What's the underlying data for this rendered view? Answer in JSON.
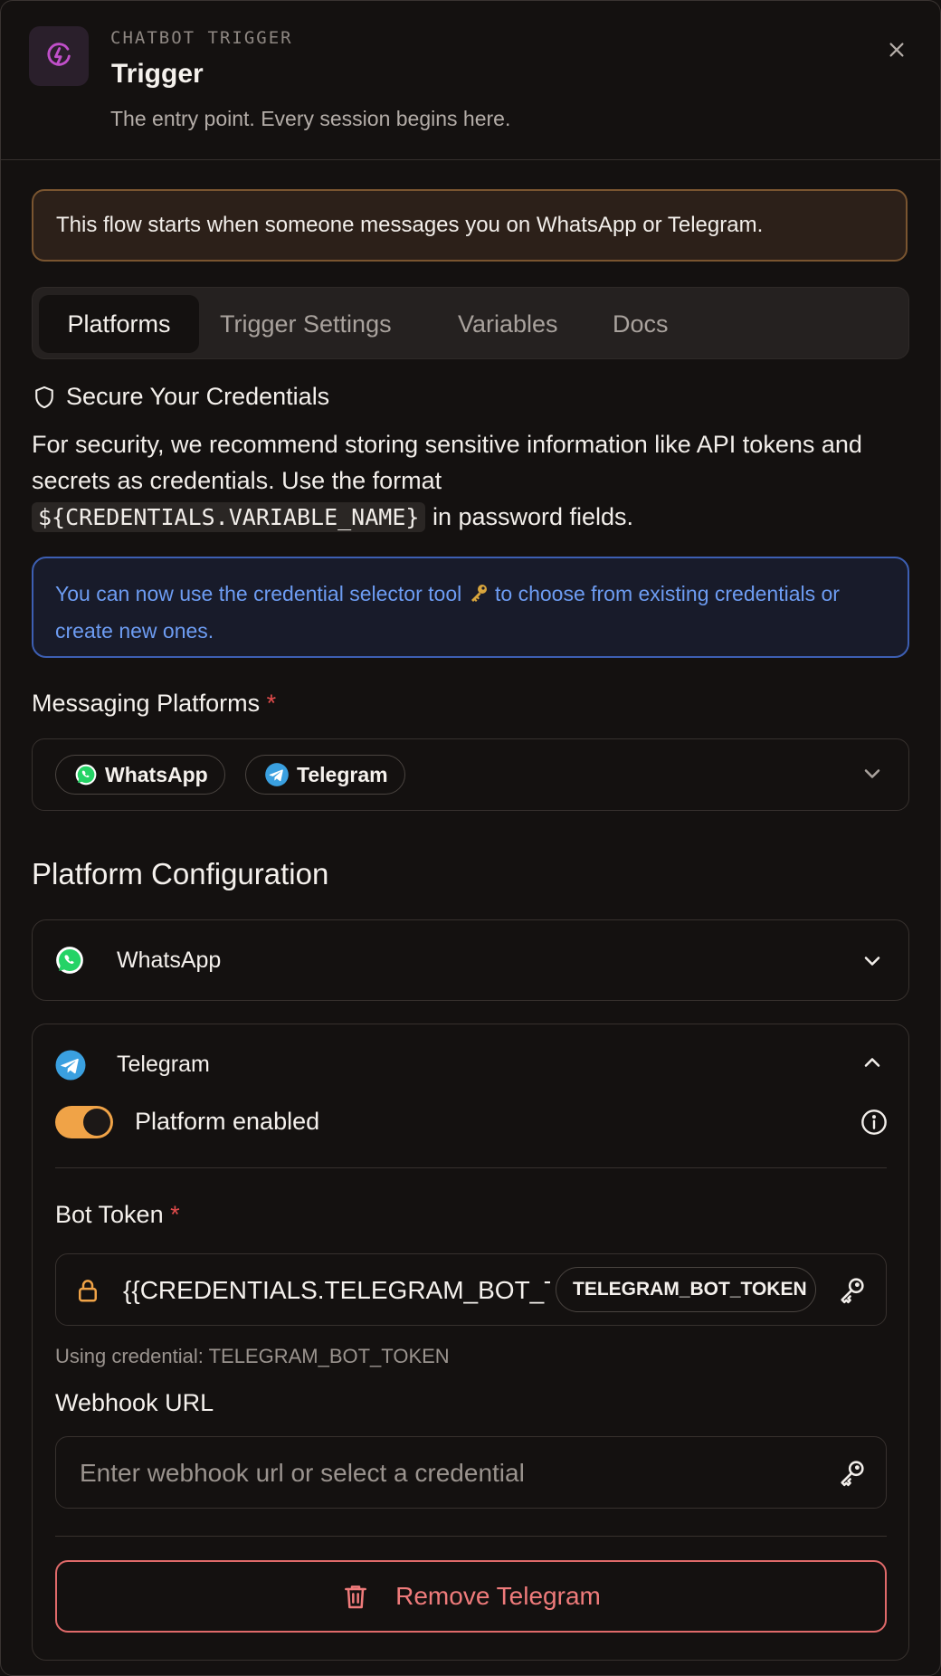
{
  "header": {
    "eyebrow": "CHATBOT TRIGGER",
    "title": "Trigger",
    "subtitle": "The entry point. Every session begins here."
  },
  "notice": "This flow starts when someone messages you on WhatsApp or Telegram.",
  "tabs": [
    {
      "label": "Platforms",
      "active": true
    },
    {
      "label": "Trigger Settings",
      "active": false
    },
    {
      "label": "Variables",
      "active": false
    },
    {
      "label": "Docs",
      "active": false
    }
  ],
  "security": {
    "heading": "Secure Your Credentials",
    "text_before": "For security, we recommend storing sensitive information like API tokens and secrets as credentials. Use the format",
    "code": "${CREDENTIALS.VARIABLE_NAME}",
    "text_after": "in password fields."
  },
  "info": {
    "text_before": "You can now use the credential selector tool",
    "text_after": "to choose from existing credentials or create new ones."
  },
  "messaging_platforms": {
    "label": "Messaging Platforms",
    "required_mark": "*",
    "chips": [
      "WhatsApp",
      "Telegram"
    ]
  },
  "platform_configuration": {
    "heading": "Platform Configuration",
    "whatsapp": {
      "title": "WhatsApp",
      "expanded": false
    },
    "telegram": {
      "title": "Telegram",
      "expanded": true,
      "enabled_label": "Platform enabled",
      "enabled": true,
      "bot_token": {
        "label": "Bot Token",
        "required_mark": "*",
        "value": "{{CREDENTIALS.TELEGRAM_BOT_TOKEN}}",
        "credential_chip": "TELEGRAM_BOT_TOKEN",
        "helper": "Using credential: TELEGRAM_BOT_TOKEN"
      },
      "webhook_url": {
        "label": "Webhook URL",
        "placeholder": "Enter webhook url or select a credential",
        "value": ""
      },
      "remove_label": "Remove Telegram"
    }
  },
  "colors": {
    "background": "#141110",
    "accent_orange": "#f0a347",
    "info_blue": "#6d9cf2",
    "danger_red": "#ef7b7b",
    "whatsapp_green": "#25d366",
    "telegram_blue": "#3aa0e0"
  },
  "icons": [
    "bolt-icon",
    "close-icon",
    "shield-icon",
    "key-icon",
    "chevron-down-icon",
    "chevron-up-icon",
    "whatsapp-icon",
    "telegram-icon",
    "info-icon",
    "lock-icon",
    "trash-icon"
  ]
}
